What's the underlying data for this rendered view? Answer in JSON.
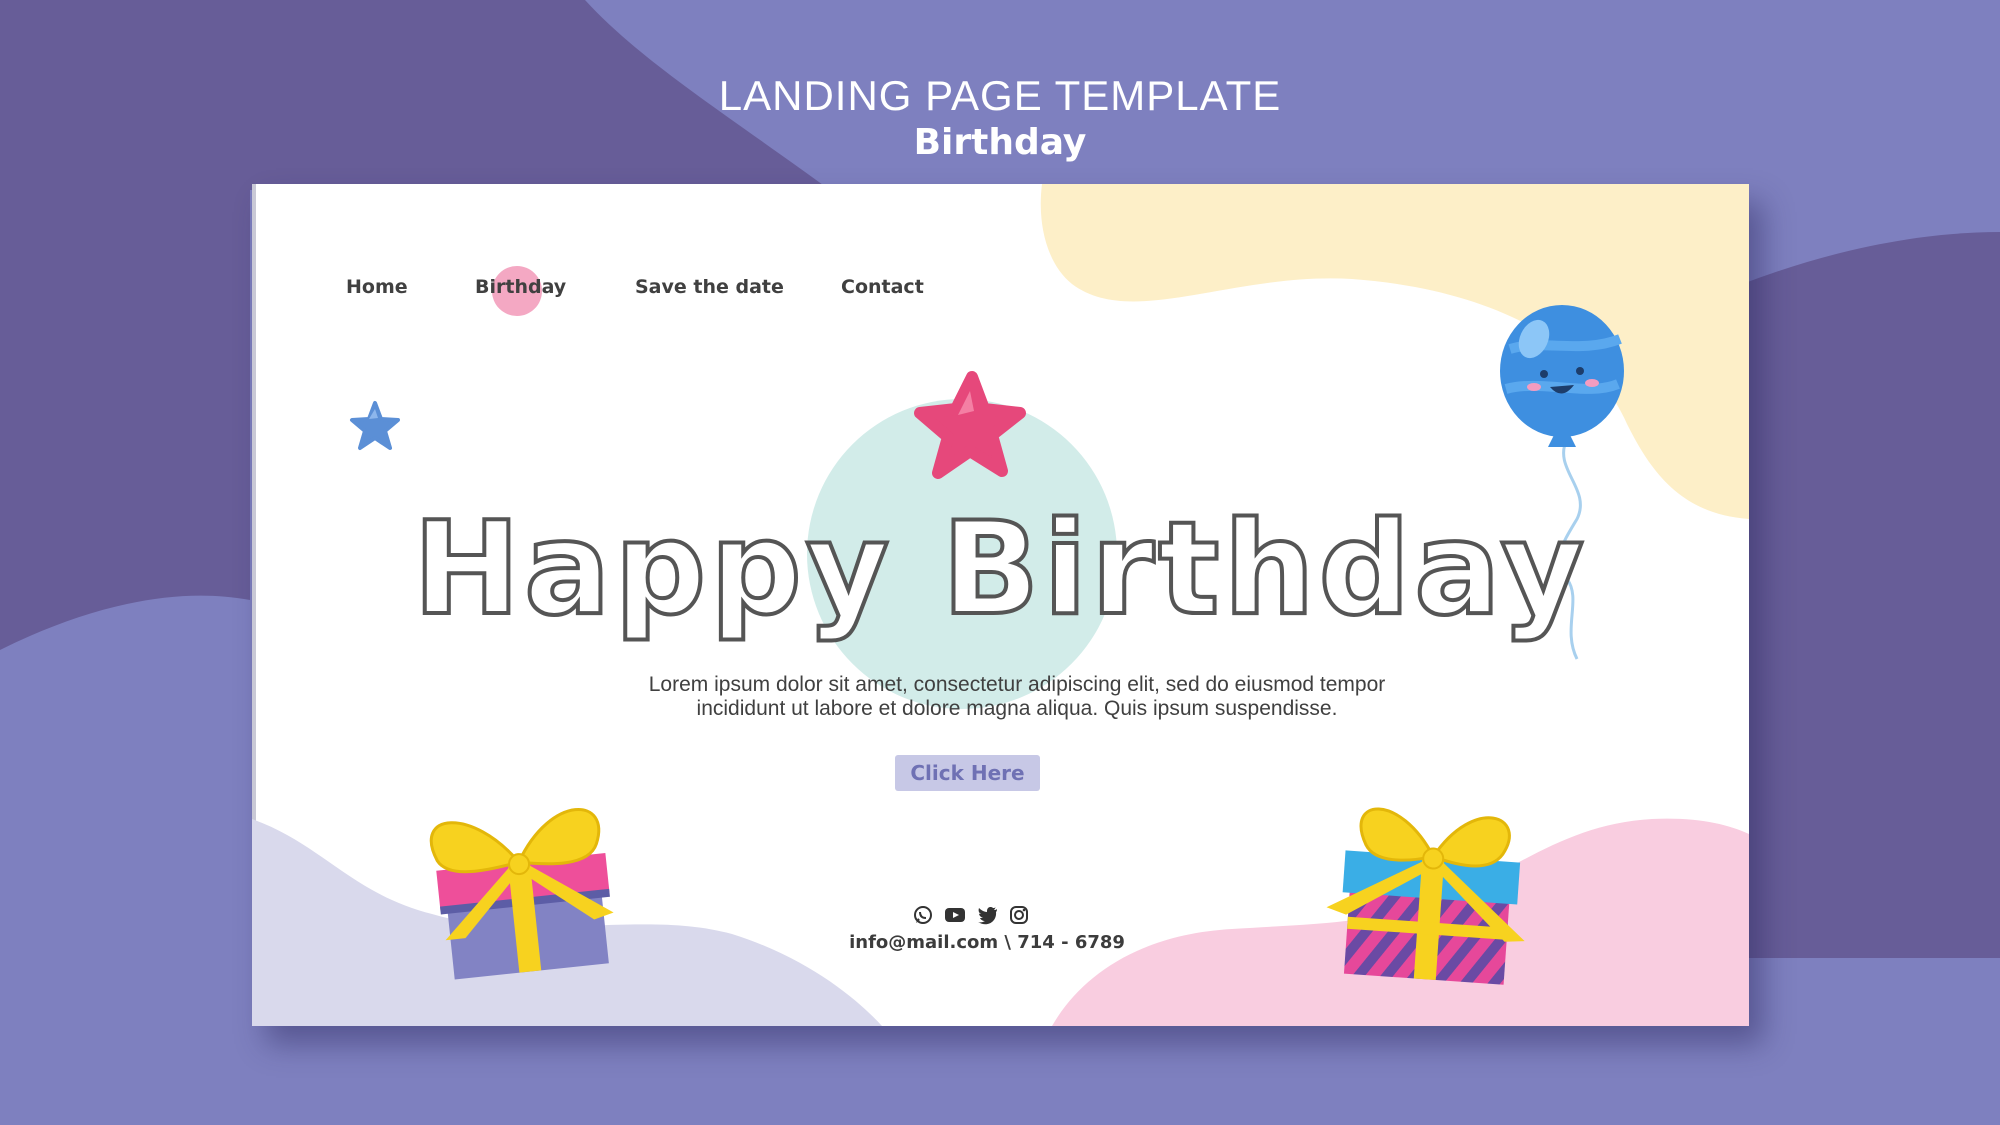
{
  "showcase": {
    "title": "LANDING PAGE TEMPLATE",
    "subtitle": "Birthday"
  },
  "colors": {
    "backdrop": "#7e80bf",
    "backdrop_dark": "#675d98",
    "card_bg": "#ffffff",
    "accent_yellow": "#fdefc8",
    "accent_pink": "#f9cde0",
    "accent_lavender": "#d9d9ec",
    "accent_mint": "#d2ece9",
    "button_bg": "#c7c8e6",
    "button_text": "#6f71b4"
  },
  "nav": {
    "items": [
      {
        "label": "Home"
      },
      {
        "label": "Birthday"
      },
      {
        "label": "Save the date"
      },
      {
        "label": "Contact"
      }
    ],
    "active": "Birthday"
  },
  "hero": {
    "title": "Happy Birthday",
    "body": "Lorem ipsum dolor sit amet, consectetur adipiscing elit, sed do eiusmod tempor incididunt ut labore et dolore magna aliqua. Quis ipsum suspendisse.",
    "cta_label": "Click Here"
  },
  "footer": {
    "social_icons": [
      "whatsapp-icon",
      "youtube-icon",
      "twitter-icon",
      "instagram-icon"
    ],
    "contact": "info@mail.com \\ 714 - 6789"
  }
}
